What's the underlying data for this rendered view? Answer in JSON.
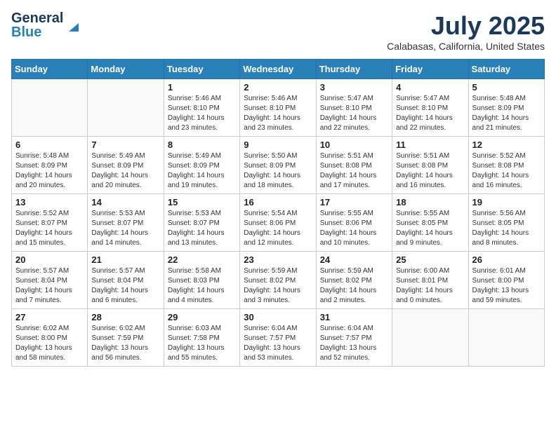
{
  "header": {
    "logo_line1": "General",
    "logo_line2": "Blue",
    "month": "July 2025",
    "location": "Calabasas, California, United States"
  },
  "weekdays": [
    "Sunday",
    "Monday",
    "Tuesday",
    "Wednesday",
    "Thursday",
    "Friday",
    "Saturday"
  ],
  "weeks": [
    [
      {
        "day": "",
        "info": ""
      },
      {
        "day": "",
        "info": ""
      },
      {
        "day": "1",
        "info": "Sunrise: 5:46 AM\nSunset: 8:10 PM\nDaylight: 14 hours and 23 minutes."
      },
      {
        "day": "2",
        "info": "Sunrise: 5:46 AM\nSunset: 8:10 PM\nDaylight: 14 hours and 23 minutes."
      },
      {
        "day": "3",
        "info": "Sunrise: 5:47 AM\nSunset: 8:10 PM\nDaylight: 14 hours and 22 minutes."
      },
      {
        "day": "4",
        "info": "Sunrise: 5:47 AM\nSunset: 8:10 PM\nDaylight: 14 hours and 22 minutes."
      },
      {
        "day": "5",
        "info": "Sunrise: 5:48 AM\nSunset: 8:09 PM\nDaylight: 14 hours and 21 minutes."
      }
    ],
    [
      {
        "day": "6",
        "info": "Sunrise: 5:48 AM\nSunset: 8:09 PM\nDaylight: 14 hours and 20 minutes."
      },
      {
        "day": "7",
        "info": "Sunrise: 5:49 AM\nSunset: 8:09 PM\nDaylight: 14 hours and 20 minutes."
      },
      {
        "day": "8",
        "info": "Sunrise: 5:49 AM\nSunset: 8:09 PM\nDaylight: 14 hours and 19 minutes."
      },
      {
        "day": "9",
        "info": "Sunrise: 5:50 AM\nSunset: 8:09 PM\nDaylight: 14 hours and 18 minutes."
      },
      {
        "day": "10",
        "info": "Sunrise: 5:51 AM\nSunset: 8:08 PM\nDaylight: 14 hours and 17 minutes."
      },
      {
        "day": "11",
        "info": "Sunrise: 5:51 AM\nSunset: 8:08 PM\nDaylight: 14 hours and 16 minutes."
      },
      {
        "day": "12",
        "info": "Sunrise: 5:52 AM\nSunset: 8:08 PM\nDaylight: 14 hours and 16 minutes."
      }
    ],
    [
      {
        "day": "13",
        "info": "Sunrise: 5:52 AM\nSunset: 8:07 PM\nDaylight: 14 hours and 15 minutes."
      },
      {
        "day": "14",
        "info": "Sunrise: 5:53 AM\nSunset: 8:07 PM\nDaylight: 14 hours and 14 minutes."
      },
      {
        "day": "15",
        "info": "Sunrise: 5:53 AM\nSunset: 8:07 PM\nDaylight: 14 hours and 13 minutes."
      },
      {
        "day": "16",
        "info": "Sunrise: 5:54 AM\nSunset: 8:06 PM\nDaylight: 14 hours and 12 minutes."
      },
      {
        "day": "17",
        "info": "Sunrise: 5:55 AM\nSunset: 8:06 PM\nDaylight: 14 hours and 10 minutes."
      },
      {
        "day": "18",
        "info": "Sunrise: 5:55 AM\nSunset: 8:05 PM\nDaylight: 14 hours and 9 minutes."
      },
      {
        "day": "19",
        "info": "Sunrise: 5:56 AM\nSunset: 8:05 PM\nDaylight: 14 hours and 8 minutes."
      }
    ],
    [
      {
        "day": "20",
        "info": "Sunrise: 5:57 AM\nSunset: 8:04 PM\nDaylight: 14 hours and 7 minutes."
      },
      {
        "day": "21",
        "info": "Sunrise: 5:57 AM\nSunset: 8:04 PM\nDaylight: 14 hours and 6 minutes."
      },
      {
        "day": "22",
        "info": "Sunrise: 5:58 AM\nSunset: 8:03 PM\nDaylight: 14 hours and 4 minutes."
      },
      {
        "day": "23",
        "info": "Sunrise: 5:59 AM\nSunset: 8:02 PM\nDaylight: 14 hours and 3 minutes."
      },
      {
        "day": "24",
        "info": "Sunrise: 5:59 AM\nSunset: 8:02 PM\nDaylight: 14 hours and 2 minutes."
      },
      {
        "day": "25",
        "info": "Sunrise: 6:00 AM\nSunset: 8:01 PM\nDaylight: 14 hours and 0 minutes."
      },
      {
        "day": "26",
        "info": "Sunrise: 6:01 AM\nSunset: 8:00 PM\nDaylight: 13 hours and 59 minutes."
      }
    ],
    [
      {
        "day": "27",
        "info": "Sunrise: 6:02 AM\nSunset: 8:00 PM\nDaylight: 13 hours and 58 minutes."
      },
      {
        "day": "28",
        "info": "Sunrise: 6:02 AM\nSunset: 7:59 PM\nDaylight: 13 hours and 56 minutes."
      },
      {
        "day": "29",
        "info": "Sunrise: 6:03 AM\nSunset: 7:58 PM\nDaylight: 13 hours and 55 minutes."
      },
      {
        "day": "30",
        "info": "Sunrise: 6:04 AM\nSunset: 7:57 PM\nDaylight: 13 hours and 53 minutes."
      },
      {
        "day": "31",
        "info": "Sunrise: 6:04 AM\nSunset: 7:57 PM\nDaylight: 13 hours and 52 minutes."
      },
      {
        "day": "",
        "info": ""
      },
      {
        "day": "",
        "info": ""
      }
    ]
  ]
}
